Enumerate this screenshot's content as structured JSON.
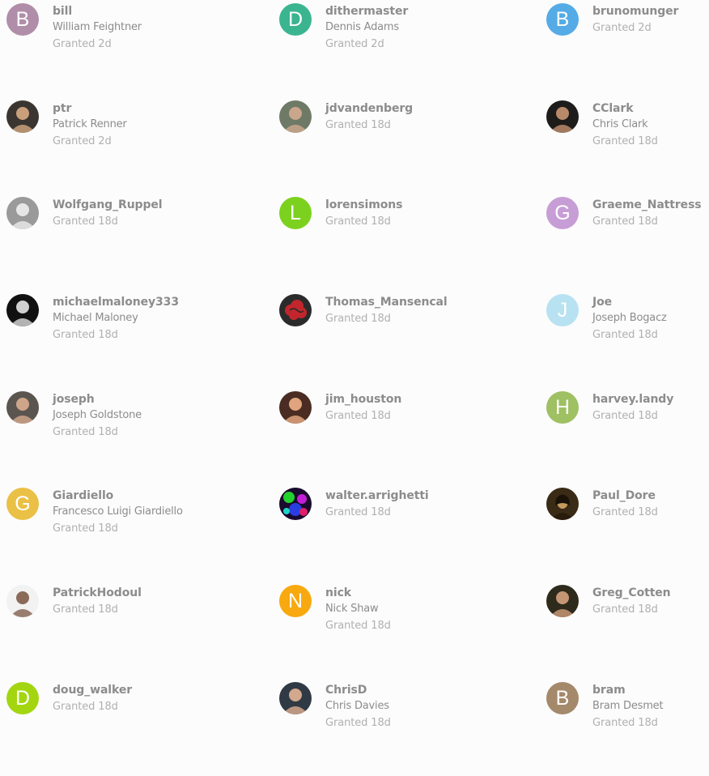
{
  "granted_label": "Granted",
  "users": [
    {
      "username": "bill",
      "fullname": "William Feightner",
      "granted": "Granted 2d",
      "avatar": {
        "type": "letter",
        "letter": "B",
        "color": "#b08ea9"
      }
    },
    {
      "username": "dithermaster",
      "fullname": "Dennis Adams",
      "granted": "Granted 2d",
      "avatar": {
        "type": "letter",
        "letter": "D",
        "color": "#3bb58f"
      }
    },
    {
      "username": "brunomunger",
      "fullname": "",
      "granted": "Granted 2d",
      "avatar": {
        "type": "letter",
        "letter": "B",
        "color": "#55abe6"
      }
    },
    {
      "username": "ptr",
      "fullname": "Patrick Renner",
      "granted": "Granted 2d",
      "avatar": {
        "type": "photo",
        "icon": "user-photo-icon",
        "bg": "#3a3530",
        "fg": "#c9a07a"
      }
    },
    {
      "username": "jdvandenberg",
      "fullname": "",
      "granted": "Granted 18d",
      "avatar": {
        "type": "photo",
        "icon": "user-photo-icon",
        "bg": "#6f7a66",
        "fg": "#caa78c"
      }
    },
    {
      "username": "CClark",
      "fullname": "Chris Clark",
      "granted": "Granted 18d",
      "avatar": {
        "type": "photo",
        "icon": "user-photo-icon",
        "bg": "#1d1c1b",
        "fg": "#b98a6a"
      }
    },
    {
      "username": "Wolfgang_Ruppel",
      "fullname": "",
      "granted": "Granted 18d",
      "avatar": {
        "type": "photo",
        "icon": "user-photo-icon",
        "bg": "#9a9a9a",
        "fg": "#e6e6e6"
      }
    },
    {
      "username": "lorensimons",
      "fullname": "",
      "granted": "Granted 18d",
      "avatar": {
        "type": "letter",
        "letter": "L",
        "color": "#7cd11f"
      }
    },
    {
      "username": "Graeme_Nattress",
      "fullname": "",
      "granted": "Granted 18d",
      "avatar": {
        "type": "letter",
        "letter": "G",
        "color": "#c79dd6"
      }
    },
    {
      "username": "michaelmaloney333",
      "fullname": "Michael Maloney",
      "granted": "Granted 18d",
      "avatar": {
        "type": "photo",
        "icon": "user-photo-icon",
        "bg": "#111111",
        "fg": "#d0d0d0"
      }
    },
    {
      "username": "Thomas_Mansencal",
      "fullname": "",
      "granted": "Granted 18d",
      "avatar": {
        "type": "photo",
        "icon": "cloud-emblem-icon",
        "bg": "#2b2b2b",
        "fg": "#c2262c"
      }
    },
    {
      "username": "Joe",
      "fullname": "Joseph Bogacz",
      "granted": "Granted 18d",
      "avatar": {
        "type": "letter",
        "letter": "J",
        "color": "#b8e2f2"
      }
    },
    {
      "username": "joseph",
      "fullname": "Joseph Goldstone",
      "granted": "Granted 18d",
      "avatar": {
        "type": "photo",
        "icon": "user-photo-icon",
        "bg": "#5b5550",
        "fg": "#cfa58a"
      }
    },
    {
      "username": "jim_houston",
      "fullname": "",
      "granted": "Granted 18d",
      "avatar": {
        "type": "photo",
        "icon": "user-photo-icon",
        "bg": "#4a2c22",
        "fg": "#e0a57e"
      }
    },
    {
      "username": "harvey.landy",
      "fullname": "",
      "granted": "Granted 18d",
      "avatar": {
        "type": "letter",
        "letter": "H",
        "color": "#9fc063"
      }
    },
    {
      "username": "Giardiello",
      "fullname": "Francesco Luigi Giardiello",
      "granted": "Granted 18d",
      "avatar": {
        "type": "letter",
        "letter": "G",
        "color": "#eac146"
      }
    },
    {
      "username": "walter.arrighetti",
      "fullname": "",
      "granted": "Granted 18d",
      "avatar": {
        "type": "photo",
        "icon": "abstract-art-icon",
        "bg": "#1a0a2e",
        "fg": "#22d12b"
      }
    },
    {
      "username": "Paul_Dore",
      "fullname": "",
      "granted": "Granted 18d",
      "avatar": {
        "type": "photo",
        "icon": "painting-icon",
        "bg": "#3a2b16",
        "fg": "#c59a5d"
      }
    },
    {
      "username": "PatrickHodoul",
      "fullname": "",
      "granted": "Granted 18d",
      "avatar": {
        "type": "photo",
        "icon": "user-photo-icon",
        "bg": "#f2f2f2",
        "fg": "#8a6a58"
      }
    },
    {
      "username": "nick",
      "fullname": "Nick Shaw",
      "granted": "Granted 18d",
      "avatar": {
        "type": "letter",
        "letter": "N",
        "color": "#f7a90f"
      }
    },
    {
      "username": "Greg_Cotten",
      "fullname": "",
      "granted": "Granted 18d",
      "avatar": {
        "type": "photo",
        "icon": "user-photo-icon",
        "bg": "#2e2a1c",
        "fg": "#c59674"
      }
    },
    {
      "username": "doug_walker",
      "fullname": "",
      "granted": "Granted 18d",
      "avatar": {
        "type": "letter",
        "letter": "D",
        "color": "#a3d611"
      }
    },
    {
      "username": "ChrisD",
      "fullname": "Chris Davies",
      "granted": "Granted 18d",
      "avatar": {
        "type": "photo",
        "icon": "user-photo-icon",
        "bg": "#2f3a44",
        "fg": "#d3a88d"
      }
    },
    {
      "username": "bram",
      "fullname": "Bram Desmet",
      "granted": "Granted 18d",
      "avatar": {
        "type": "letter",
        "letter": "B",
        "color": "#a4896a"
      }
    }
  ]
}
